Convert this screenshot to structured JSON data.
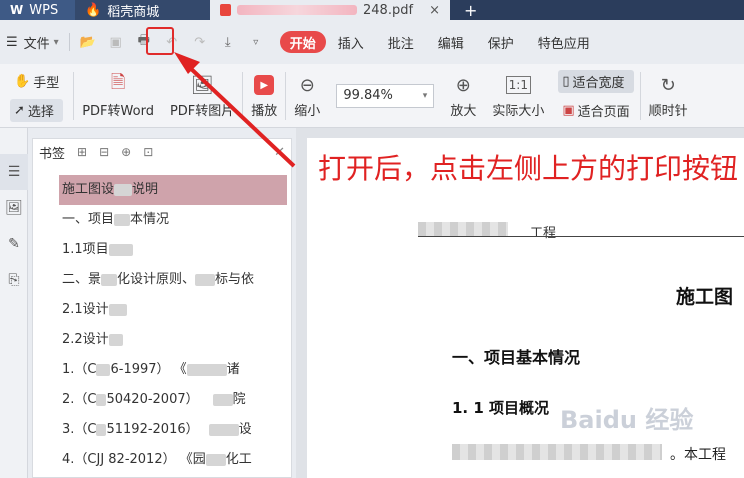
{
  "tabs": {
    "wps": "WPS",
    "shop": "稻壳商城",
    "doc_visible": "248.pdf",
    "close": "×",
    "add": "+"
  },
  "menu": {
    "file": "文件",
    "ribbon_tabs": [
      "开始",
      "插入",
      "批注",
      "编辑",
      "保护",
      "特色应用"
    ]
  },
  "ribbon": {
    "hand": "手型",
    "select": "选择",
    "pdf_to_word": "PDF转Word",
    "pdf_to_image": "PDF转图片",
    "play": "播放",
    "zoom_out": "缩小",
    "zoom_value": "99.84%",
    "zoom_in": "放大",
    "actual_size": "实际大小",
    "fit_width": "适合宽度",
    "fit_page": "适合页面",
    "rotate_clockwise": "顺时针"
  },
  "bookmarks": {
    "title": "书签",
    "items": [
      {
        "prefix": "施工图设",
        "suffix": "说明"
      },
      {
        "prefix": "一、项目",
        "suffix": "本情况"
      },
      {
        "prefix": "1.1项目",
        "suffix": ""
      },
      {
        "prefix": "二、景",
        "suffix": "化设计原则、",
        "tail": "标与依"
      },
      {
        "prefix": "2.1设计",
        "suffix": ""
      },
      {
        "prefix": "2.2设计",
        "suffix": ""
      },
      {
        "prefix": "1.（C",
        "suffix": "6-1997）  《",
        "tail": "诸"
      },
      {
        "prefix": "2.（C",
        "suffix": "50420-2007）",
        "tail": "院"
      },
      {
        "prefix": "3.（C",
        "suffix": "51192-2016）",
        "tail": "设"
      },
      {
        "prefix": "4.（CJJ 82-2012）  《园",
        "suffix": "",
        "tail": "化工"
      }
    ]
  },
  "document": {
    "top_fragment": "工程",
    "heading1": "施工图",
    "heading2": "一、项目基本情况",
    "heading3": "1. 1 项目概况",
    "body_fragment": "。本工程"
  },
  "annotation": {
    "text": "打开后，点击左侧上方的打印按钮"
  },
  "watermark": "Baidu 经验"
}
